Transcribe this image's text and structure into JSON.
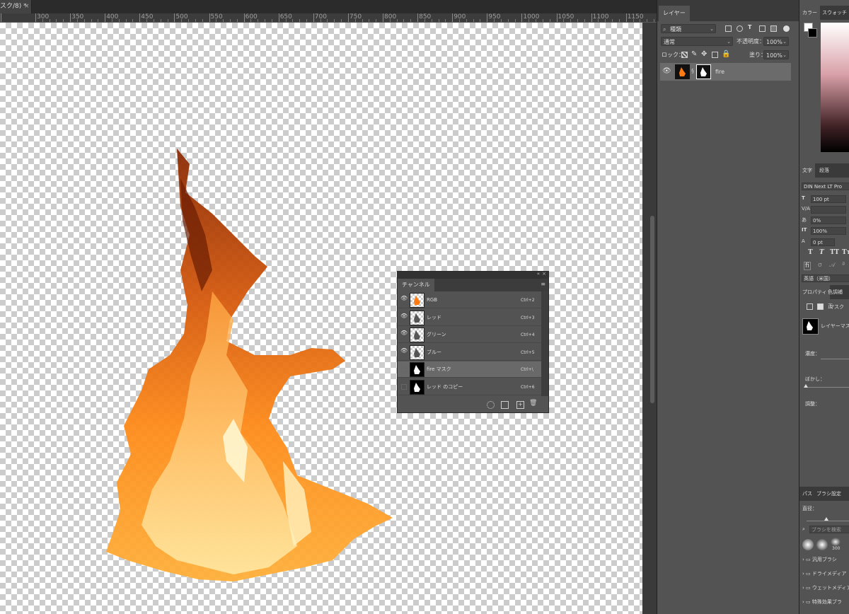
{
  "document": {
    "tab_title": "スク/8) *",
    "close_glyph": "×",
    "ruler_labels": [
      "300",
      "350",
      "400",
      "450",
      "500",
      "550",
      "600",
      "650",
      "700",
      "750",
      "800",
      "850",
      "900",
      "950",
      "1000",
      "1050",
      "1100",
      "1150"
    ]
  },
  "layers_panel": {
    "tab_label": "レイヤー",
    "filter_kind": "種類",
    "blend_mode": "通常",
    "opacity_label": "不透明度：",
    "opacity_value": "100%",
    "lock_label": "ロック：",
    "fill_label": "塗り：",
    "fill_value": "100%",
    "layers": [
      {
        "name": "fire",
        "visible": true,
        "has_mask": true
      }
    ]
  },
  "channels_panel": {
    "tab_label": "チャンネル",
    "channels": [
      {
        "name": "RGB",
        "shortcut": "Ctrl+2",
        "visible": true,
        "thumb": "color"
      },
      {
        "name": "レッド",
        "shortcut": "Ctrl+3",
        "visible": true,
        "thumb": "checker"
      },
      {
        "name": "グリーン",
        "shortcut": "Ctrl+4",
        "visible": true,
        "thumb": "checker"
      },
      {
        "name": "ブルー",
        "shortcut": "Ctrl+5",
        "visible": true,
        "thumb": "checker"
      },
      {
        "name": "fire マスク",
        "shortcut": "Ctrl+\\",
        "visible": false,
        "selected": true,
        "thumb": "mask"
      },
      {
        "name": "レッド のコピー",
        "shortcut": "Ctrl+6",
        "visible": false,
        "thumb": "mask"
      }
    ]
  },
  "color_panel": {
    "tab_label": "カラー",
    "swatches_tab": "スウォッチ",
    "foreground": "#ffffff",
    "background": "#000000"
  },
  "character_panel": {
    "tab_label": "文字",
    "paragraph_tab": "段落",
    "font": "DIN Next LT Pro",
    "size": "100 pt",
    "tracking": "0%",
    "scale": "100%",
    "baseline": "0 pt",
    "language": "英語（米国）",
    "style_buttons": [
      "T",
      "T",
      "TT",
      "Tт"
    ]
  },
  "properties_panel": {
    "tab_label": "プロパティ",
    "other_tab": "色調補正",
    "mask_label": "マスク",
    "layer_mask_label": "レイヤーマスク",
    "density_label": "濃度：",
    "feather_label": "ぼかし：",
    "adjust_label": "調整："
  },
  "brush_panel": {
    "paths_tab": "パス",
    "brush_settings_tab": "ブラシ設定",
    "size_label": "直径：",
    "search_placeholder": "ブラシを検索",
    "preset_size": "300",
    "folders": [
      "汎用ブラシ",
      "ドライメディア",
      "ウェットメディア",
      "特殊効果ブラ"
    ]
  },
  "colors": {
    "accent_fire": "#ff7a10",
    "panel_bg": "#535353",
    "app_bg": "#282828"
  }
}
